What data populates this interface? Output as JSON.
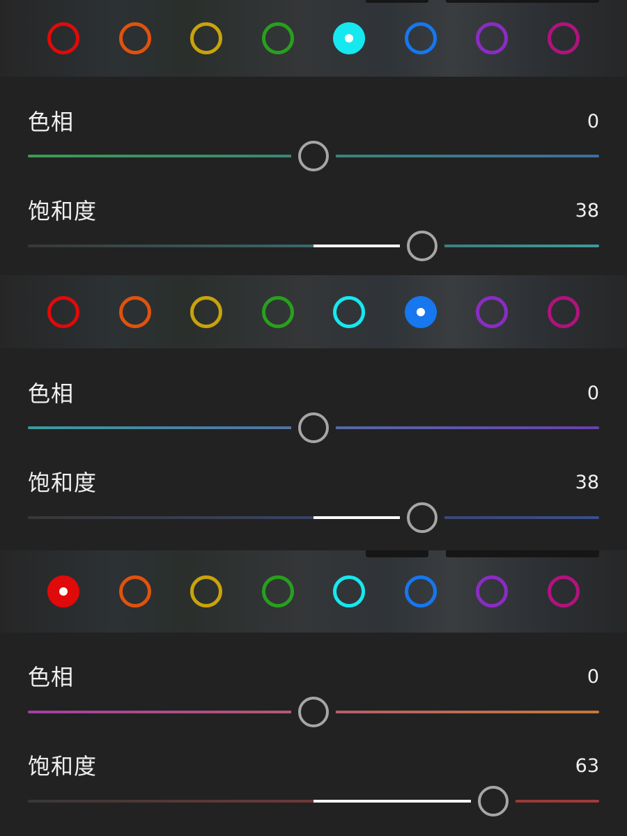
{
  "colors": {
    "red": "#e00a0a",
    "orange": "#e0520e",
    "yellow": "#c9a30c",
    "green": "#27a01d",
    "aqua": "#16e8f0",
    "blue": "#1677ef",
    "purple": "#8a2cc4",
    "magenta": "#b0137c",
    "fill": "#ffffff",
    "thumb_ring": "#a6a6a6"
  },
  "panels": [
    {
      "selected_color": "aqua",
      "hue": {
        "label": "色相",
        "value": "0",
        "level": 0,
        "min": -100,
        "max": 100,
        "track": [
          "#3a9d52",
          "#3b6f9e"
        ]
      },
      "saturation": {
        "label": "饱和度",
        "value": "38",
        "level": 38,
        "min": -100,
        "max": 100,
        "track": [
          "#383838",
          "#3e9a9c"
        ]
      }
    },
    {
      "selected_color": "blue",
      "hue": {
        "label": "色相",
        "value": "0",
        "level": 0,
        "min": -100,
        "max": 100,
        "track": [
          "#3a9c9e",
          "#6a3fb0"
        ]
      },
      "saturation": {
        "label": "饱和度",
        "value": "38",
        "level": 38,
        "min": -100,
        "max": 100,
        "track": [
          "#383838",
          "#3a4e8f"
        ]
      }
    },
    {
      "selected_color": "red",
      "hue": {
        "label": "色相",
        "value": "0",
        "level": 0,
        "min": -100,
        "max": 100,
        "track": [
          "#a33fa0",
          "#c47a3a"
        ]
      },
      "saturation": {
        "label": "饱和度",
        "value": "63",
        "level": 63,
        "min": -100,
        "max": 100,
        "track": [
          "#383838",
          "#a33a3a"
        ]
      }
    }
  ]
}
